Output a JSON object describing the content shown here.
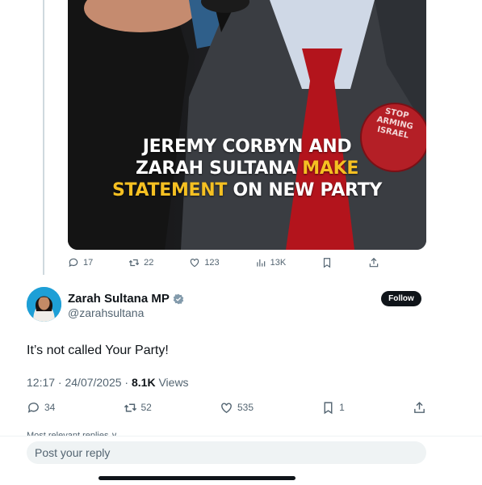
{
  "media": {
    "headline_white_1": "JEREMY CORBYN AND",
    "headline_white_2": "ZARAH SULTANA ",
    "headline_yellow_1": "MAKE",
    "headline_yellow_2": "STATEMENT",
    "headline_white_3": " ON NEW PARTY",
    "badge_line_1": "STOP",
    "badge_line_2": "ARMING",
    "badge_line_3": "ISRAEL"
  },
  "quoted_actions": {
    "replies": "17",
    "reposts": "22",
    "likes": "123",
    "views": "13K"
  },
  "tweet": {
    "author_name": "Zarah Sultana MP",
    "author_handle": "@zarahsultana",
    "follow_label": "Follow",
    "text": "It’s not called Your Party!",
    "timestamp": "12:17 · 24/07/2025 · ",
    "views_count": "8.1K",
    "views_label": " Views"
  },
  "tweet_actions": {
    "replies": "34",
    "reposts": "52",
    "likes": "535",
    "bookmarks": "1"
  },
  "replies_sort_label": "Most relevant replies ∨",
  "reply_placeholder": "Post your reply",
  "colors": {
    "accent_yellow": "#f5c022",
    "text_primary": "#0f1419",
    "text_secondary": "#536471",
    "verified_badge": "#829aab"
  },
  "icons": [
    "reply-icon",
    "repost-icon",
    "like-icon",
    "views-icon",
    "bookmark-icon",
    "share-icon",
    "verified-badge-icon"
  ]
}
